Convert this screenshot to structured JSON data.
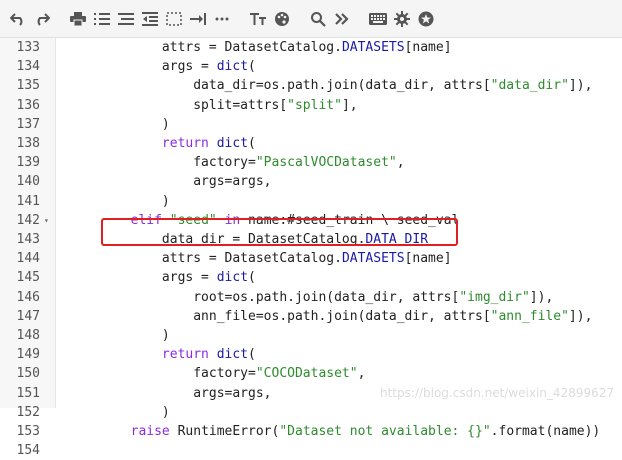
{
  "toolbar": {
    "buttons": [
      {
        "name": "undo-icon"
      },
      {
        "name": "redo-icon"
      },
      {
        "name": "print-icon"
      },
      {
        "name": "numbered-list-icon"
      },
      {
        "name": "bulleted-list-icon"
      },
      {
        "name": "decrease-indent-icon"
      },
      {
        "name": "select-icon"
      },
      {
        "name": "indent-icon"
      },
      {
        "name": "more-icon"
      },
      {
        "name": "text-format-icon"
      },
      {
        "name": "palette-icon"
      },
      {
        "name": "search-icon"
      },
      {
        "name": "expand-icon"
      },
      {
        "name": "keyboard-icon"
      },
      {
        "name": "gear-icon"
      },
      {
        "name": "star-icon"
      }
    ]
  },
  "editor": {
    "lines": [
      {
        "num": "133",
        "tokens": [
          {
            "t": "            attrs = DatasetCatalog.",
            "c": ""
          },
          {
            "t": "DATASETS",
            "c": "con"
          },
          {
            "t": "[name]",
            "c": ""
          }
        ]
      },
      {
        "num": "134",
        "tokens": [
          {
            "t": "            args = ",
            "c": ""
          },
          {
            "t": "dict",
            "c": "builtin"
          },
          {
            "t": "(",
            "c": ""
          }
        ]
      },
      {
        "num": "135",
        "tokens": [
          {
            "t": "                data_dir=os.path.join(data_dir, attrs[",
            "c": ""
          },
          {
            "t": "\"data_dir\"",
            "c": "str"
          },
          {
            "t": "]),",
            "c": ""
          }
        ]
      },
      {
        "num": "136",
        "tokens": [
          {
            "t": "                split=attrs[",
            "c": ""
          },
          {
            "t": "\"split\"",
            "c": "str"
          },
          {
            "t": "],",
            "c": ""
          }
        ]
      },
      {
        "num": "137",
        "tokens": [
          {
            "t": "            )",
            "c": ""
          }
        ]
      },
      {
        "num": "138",
        "tokens": [
          {
            "t": "            ",
            "c": ""
          },
          {
            "t": "return",
            "c": "kw"
          },
          {
            "t": " ",
            "c": ""
          },
          {
            "t": "dict",
            "c": "builtin"
          },
          {
            "t": "(",
            "c": ""
          }
        ]
      },
      {
        "num": "139",
        "tokens": [
          {
            "t": "                factory=",
            "c": ""
          },
          {
            "t": "\"PascalVOCDataset\"",
            "c": "str"
          },
          {
            "t": ",",
            "c": ""
          }
        ]
      },
      {
        "num": "140",
        "tokens": [
          {
            "t": "                args=args,",
            "c": ""
          }
        ]
      },
      {
        "num": "141",
        "tokens": [
          {
            "t": "            )",
            "c": ""
          }
        ]
      },
      {
        "num": "142",
        "fold": "▾",
        "tokens": [
          {
            "t": "        ",
            "c": ""
          },
          {
            "t": "elif",
            "c": "kw"
          },
          {
            "t": " ",
            "c": ""
          },
          {
            "t": "\"seed\"",
            "c": "str"
          },
          {
            "t": " ",
            "c": ""
          },
          {
            "t": "in",
            "c": "kw"
          },
          {
            "t": " name:#seed_train \\ seed_val",
            "c": ""
          }
        ]
      },
      {
        "num": "143",
        "tokens": [
          {
            "t": "            data_dir = DatasetCatalog.",
            "c": ""
          },
          {
            "t": "DATA_DIR",
            "c": "con"
          }
        ]
      },
      {
        "num": "144",
        "tokens": [
          {
            "t": "            attrs = DatasetCatalog.",
            "c": ""
          },
          {
            "t": "DATASETS",
            "c": "con"
          },
          {
            "t": "[name]",
            "c": ""
          }
        ]
      },
      {
        "num": "145",
        "tokens": [
          {
            "t": "            args = ",
            "c": ""
          },
          {
            "t": "dict",
            "c": "builtin"
          },
          {
            "t": "(",
            "c": ""
          }
        ]
      },
      {
        "num": "146",
        "tokens": [
          {
            "t": "                root=os.path.join(data_dir, attrs[",
            "c": ""
          },
          {
            "t": "\"img_dir\"",
            "c": "str"
          },
          {
            "t": "]),",
            "c": ""
          }
        ]
      },
      {
        "num": "147",
        "tokens": [
          {
            "t": "                ann_file=os.path.join(data_dir, attrs[",
            "c": ""
          },
          {
            "t": "\"ann_file\"",
            "c": "str"
          },
          {
            "t": "]),",
            "c": ""
          }
        ]
      },
      {
        "num": "148",
        "tokens": [
          {
            "t": "            )",
            "c": ""
          }
        ]
      },
      {
        "num": "149",
        "tokens": [
          {
            "t": "            ",
            "c": ""
          },
          {
            "t": "return",
            "c": "kw"
          },
          {
            "t": " ",
            "c": ""
          },
          {
            "t": "dict",
            "c": "builtin"
          },
          {
            "t": "(",
            "c": ""
          }
        ]
      },
      {
        "num": "150",
        "tokens": [
          {
            "t": "                factory=",
            "c": ""
          },
          {
            "t": "\"COCODataset\"",
            "c": "str"
          },
          {
            "t": ",",
            "c": ""
          }
        ]
      },
      {
        "num": "151",
        "tokens": [
          {
            "t": "                args=args,",
            "c": ""
          }
        ]
      },
      {
        "num": "152",
        "tokens": [
          {
            "t": "            )",
            "c": ""
          }
        ]
      },
      {
        "num": "153",
        "tokens": [
          {
            "t": "        ",
            "c": ""
          },
          {
            "t": "raise",
            "c": "kw"
          },
          {
            "t": " RuntimeError(",
            "c": ""
          },
          {
            "t": "\"Dataset not available: {}\"",
            "c": "str"
          },
          {
            "t": ".format(name))",
            "c": ""
          }
        ]
      },
      {
        "num": "154",
        "tokens": []
      }
    ]
  },
  "watermark": "https://blog.csdn.net/weixin_42899627",
  "colors": {
    "highlight_border": "#e02020",
    "keyword": "#8a2be2",
    "string": "#2e8b2e"
  }
}
